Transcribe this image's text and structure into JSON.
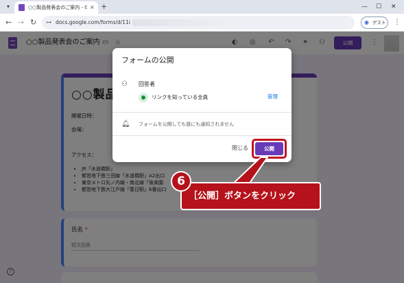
{
  "browser": {
    "tab_title": "○○製品発表会のご案内 - Google",
    "tab_close": "×",
    "new_tab": "+",
    "url": "docs.google.com/forms/d/11i",
    "guest_label": "ゲスト",
    "win_min": "—",
    "win_max": "☐",
    "win_close": "✕"
  },
  "app": {
    "doc_title": "○○製品発表会のご案内",
    "publish_label": "公開"
  },
  "form": {
    "title": "○○製品発",
    "date_label": "開催日時：",
    "venue_label": "会場：",
    "access_label": "アクセス：",
    "access_items": [
      "JR「水道橋駅」",
      "都営地下鉄三田線「水道橋駅」A2出口",
      "東京メトロ丸ノ内線・南北線「後楽園",
      "都営地下鉄大江戸線「春日駅」6番出口"
    ],
    "name_label": "氏名",
    "required_mark": " *",
    "name_placeholder": "短文回答"
  },
  "dialog": {
    "title": "フォームの公開",
    "respondents_label": "回答者",
    "link_access": "リンクを知っている全員",
    "manage_label": "管理",
    "notice": "フォームを公開しても誰にも通知されません",
    "close_label": "閉じる",
    "publish_label": "公開"
  },
  "annotation": {
    "step_number": "6",
    "callout_text": "［公開］ボタンをクリック"
  },
  "colors": {
    "brand_purple": "#673ab7",
    "callout_red": "#b5121b",
    "link_blue": "#1a73e8"
  },
  "icons": {
    "back": "arrow-left",
    "forward": "arrow-right",
    "reload": "reload",
    "respondents": "person-add",
    "globe": "globe",
    "bell": "bell",
    "help": "help"
  }
}
